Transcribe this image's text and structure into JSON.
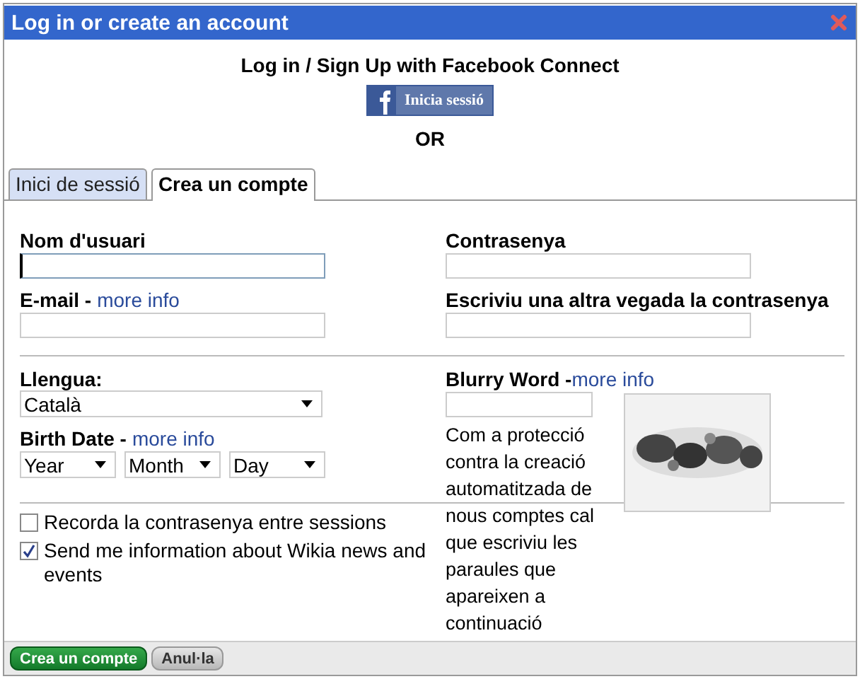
{
  "window": {
    "title": "Log in or create an account"
  },
  "facebook": {
    "heading": "Log in / Sign Up with Facebook Connect",
    "button": "Inicia sessió",
    "or": "OR"
  },
  "tabs": [
    {
      "label": "Inici de sessió",
      "selected": false
    },
    {
      "label": "Crea un compte",
      "selected": true
    }
  ],
  "account": {
    "username_label": "Nom d'usuari",
    "email_label": "E-mail -",
    "email_link": "more info",
    "password_label": "Contrasenya",
    "retype_label": "Escriviu una altra vegada la contrasenya"
  },
  "language": {
    "label": "Llengua:",
    "value": "Català"
  },
  "birth_date": {
    "label": "Birth Date -",
    "link": "more info",
    "selects": [
      "Year",
      "Month",
      "Day"
    ]
  },
  "captcha": {
    "label": "Blurry Word -",
    "link": "more info",
    "text": "Com a protecció contra la creació automatitzada de nous comptes cal que escriviu les paraules que apareixen a continuació"
  },
  "options": [
    {
      "label": "Recorda la contrasenya entre sessions",
      "checked": false
    },
    {
      "label": "Send me information about Wikia news and events",
      "checked": true
    }
  ],
  "buttons": [
    {
      "label": "Crea un compte",
      "kind": "primary"
    },
    {
      "label": "Anul·la",
      "kind": "secondary"
    }
  ]
}
